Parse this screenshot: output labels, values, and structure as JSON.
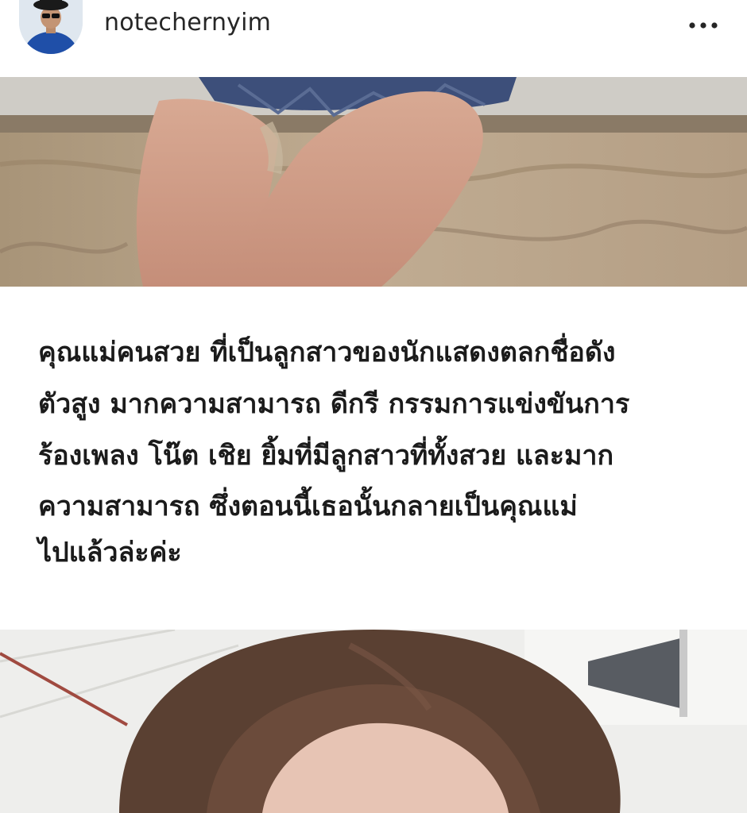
{
  "post": {
    "username": "notechernyim",
    "avatar_icon": "profile-photo-icon",
    "more_icon": "more-options-icon"
  },
  "caption": {
    "lines": [
      "คุณแม่คนสวย ที่เป็นลูกสาวของนักแสดงตลกชื่อดัง",
      "ตัวสูง มากความสามารถ ดีกรี กรรมการแข่งขันการ",
      "ร้องเพลง โน๊ต เชิย ยิ้มที่มีลูกสาวที่ทั้งสวย และมาก",
      "ความสามารถ ซึ่งตอนนี้เธอนั้นกลายเป็นคุณแม่",
      "ไปแล้วล่ะค่ะ"
    ]
  }
}
